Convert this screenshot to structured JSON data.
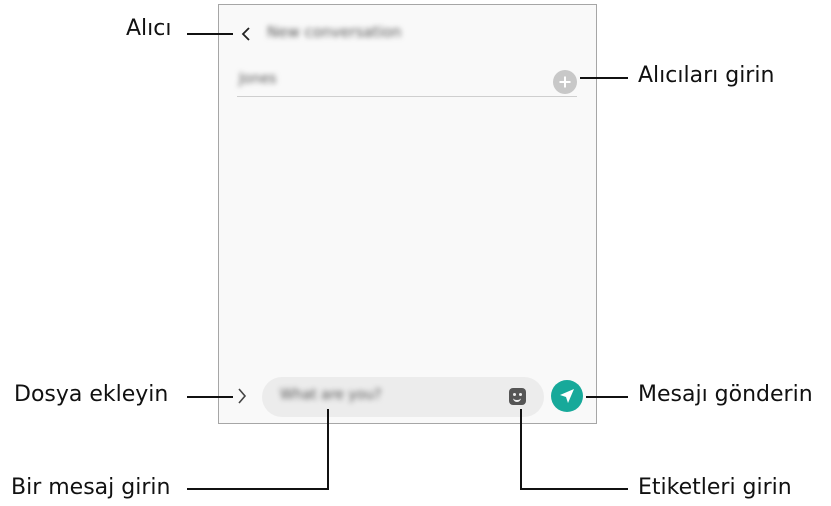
{
  "phone": {
    "title": "New conversation",
    "recipient_placeholder": "Jones",
    "message_placeholder": "What are you?"
  },
  "callouts": {
    "recipient": "Alıcı",
    "enter_recipients": "Alıcıları girin",
    "attach_file": "Dosya ekleyin",
    "send_message": "Mesajı gönderin",
    "enter_message": "Bir mesaj girin",
    "enter_stickers": "Etiketleri girin"
  },
  "colors": {
    "send_button": "#17a99a",
    "screen_bg": "#f9f9f9",
    "input_bg": "#ececec"
  },
  "icons": [
    "back-icon",
    "add-recipient-icon",
    "attach-icon",
    "sticker-icon",
    "send-icon"
  ]
}
